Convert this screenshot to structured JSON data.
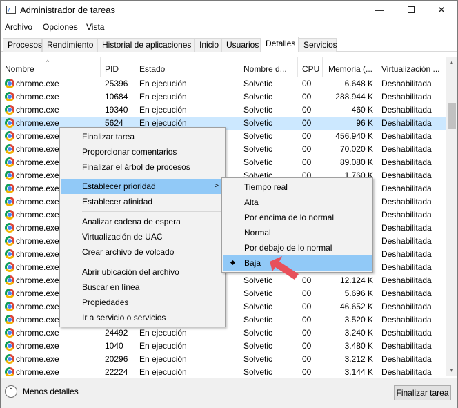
{
  "window": {
    "title": "Administrador de tareas",
    "min_glyph": "—",
    "close_glyph": "✕"
  },
  "menu": [
    "Archivo",
    "Opciones",
    "Vista"
  ],
  "tabs": [
    "Procesos",
    "Rendimiento",
    "Historial de aplicaciones",
    "Inicio",
    "Usuarios",
    "Detalles",
    "Servicios"
  ],
  "active_tab": "Detalles",
  "columns": [
    "Nombre",
    "PID",
    "Estado",
    "Nombre d...",
    "CPU",
    "Memoria (...",
    "Virtualización ..."
  ],
  "rows": [
    {
      "name": "chrome.exe",
      "pid": "25396",
      "status": "En ejecución",
      "user": "Solvetic",
      "cpu": "00",
      "mem": "6.648 K",
      "virt": "Deshabilitada"
    },
    {
      "name": "chrome.exe",
      "pid": "10684",
      "status": "En ejecución",
      "user": "Solvetic",
      "cpu": "00",
      "mem": "288.944 K",
      "virt": "Deshabilitada"
    },
    {
      "name": "chrome.exe",
      "pid": "19340",
      "status": "En ejecución",
      "user": "Solvetic",
      "cpu": "00",
      "mem": "460 K",
      "virt": "Deshabilitada"
    },
    {
      "name": "chrome.exe",
      "pid": "5624",
      "status": "En ejecución",
      "user": "Solvetic",
      "cpu": "00",
      "mem": "96 K",
      "virt": "Deshabilitada"
    },
    {
      "name": "chrome.exe",
      "pid": "",
      "status": "",
      "user": "Solvetic",
      "cpu": "00",
      "mem": "456.940 K",
      "virt": "Deshabilitada"
    },
    {
      "name": "chrome.exe",
      "pid": "",
      "status": "",
      "user": "Solvetic",
      "cpu": "00",
      "mem": "70.020 K",
      "virt": "Deshabilitada"
    },
    {
      "name": "chrome.exe",
      "pid": "",
      "status": "",
      "user": "Solvetic",
      "cpu": "00",
      "mem": "89.080 K",
      "virt": "Deshabilitada"
    },
    {
      "name": "chrome.exe",
      "pid": "",
      "status": "",
      "user": "Solvetic",
      "cpu": "00",
      "mem": "1.760 K",
      "virt": "Deshabilitada"
    },
    {
      "name": "chrome.exe",
      "pid": "",
      "status": "",
      "user": "",
      "cpu": "",
      "mem": "",
      "virt": "Deshabilitada"
    },
    {
      "name": "chrome.exe",
      "pid": "",
      "status": "",
      "user": "",
      "cpu": "",
      "mem": "",
      "virt": "Deshabilitada"
    },
    {
      "name": "chrome.exe",
      "pid": "",
      "status": "",
      "user": "",
      "cpu": "",
      "mem": "",
      "virt": "Deshabilitada"
    },
    {
      "name": "chrome.exe",
      "pid": "",
      "status": "",
      "user": "",
      "cpu": "",
      "mem": "",
      "virt": "Deshabilitada"
    },
    {
      "name": "chrome.exe",
      "pid": "",
      "status": "",
      "user": "",
      "cpu": "",
      "mem": "",
      "virt": "Deshabilitada"
    },
    {
      "name": "chrome.exe",
      "pid": "",
      "status": "",
      "user": "",
      "cpu": "",
      "mem": "",
      "virt": "Deshabilitada"
    },
    {
      "name": "chrome.exe",
      "pid": "",
      "status": "",
      "user": "",
      "cpu": "",
      "mem": "",
      "virt": "Deshabilitada"
    },
    {
      "name": "chrome.exe",
      "pid": "",
      "status": "",
      "user": "Solvetic",
      "cpu": "00",
      "mem": "12.124 K",
      "virt": "Deshabilitada"
    },
    {
      "name": "chrome.exe",
      "pid": "",
      "status": "",
      "user": "Solvetic",
      "cpu": "00",
      "mem": "5.696 K",
      "virt": "Deshabilitada"
    },
    {
      "name": "chrome.exe",
      "pid": "",
      "status": "",
      "user": "Solvetic",
      "cpu": "00",
      "mem": "46.652 K",
      "virt": "Deshabilitada"
    },
    {
      "name": "chrome.exe",
      "pid": "",
      "status": "",
      "user": "Solvetic",
      "cpu": "00",
      "mem": "3.520 K",
      "virt": "Deshabilitada"
    },
    {
      "name": "chrome.exe",
      "pid": "24492",
      "status": "En ejecución",
      "user": "Solvetic",
      "cpu": "00",
      "mem": "3.240 K",
      "virt": "Deshabilitada"
    },
    {
      "name": "chrome.exe",
      "pid": "1040",
      "status": "En ejecución",
      "user": "Solvetic",
      "cpu": "00",
      "mem": "3.480 K",
      "virt": "Deshabilitada"
    },
    {
      "name": "chrome.exe",
      "pid": "20296",
      "status": "En ejecución",
      "user": "Solvetic",
      "cpu": "00",
      "mem": "3.212 K",
      "virt": "Deshabilitada"
    },
    {
      "name": "chrome.exe",
      "pid": "22224",
      "status": "En ejecución",
      "user": "Solvetic",
      "cpu": "00",
      "mem": "3.144 K",
      "virt": "Deshabilitada"
    }
  ],
  "selected_row": 3,
  "context_menu": [
    "Finalizar tarea",
    "Proporcionar comentarios",
    "Finalizar el árbol de procesos",
    "Establecer prioridad",
    "Establecer afinidad",
    "Analizar cadena de espera",
    "Virtualización de UAC",
    "Crear archivo de volcado",
    "Abrir ubicación del archivo",
    "Buscar en línea",
    "Propiedades",
    "Ir a servicio o servicios"
  ],
  "priority_menu": [
    "Tiempo real",
    "Alta",
    "Por encima de lo normal",
    "Normal",
    "Por debajo de lo normal",
    "Baja"
  ],
  "priority_selected": "Baja",
  "footer": {
    "less_details": "Menos detalles",
    "end_task": "Finalizar tarea"
  },
  "colors": {
    "selection": "#cce8ff",
    "menu_highlight": "#91c9f7",
    "annotation_arrow": "#e8505b"
  }
}
